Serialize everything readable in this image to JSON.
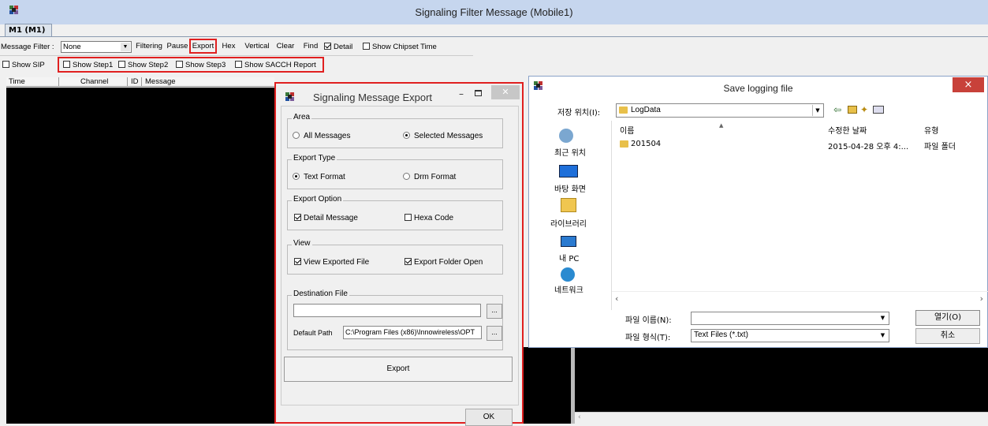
{
  "window": {
    "title": "Signaling Filter Message (Mobile1)"
  },
  "tab": {
    "label": "M1 (M1)"
  },
  "toolbar": {
    "filter_label": "Message Filter :",
    "filter_value": "None",
    "filtering": "Filtering",
    "pause": "Pause",
    "export": "Export",
    "hex": "Hex",
    "vertical": "Vertical",
    "clear": "Clear",
    "find": "Find",
    "detail": "Detail",
    "show_chipset_time": "Show Chipset Time"
  },
  "toolbar2": {
    "show_sip": "Show SIP",
    "show_step1": "Show Step1",
    "show_step2": "Show Step2",
    "show_step3": "Show Step3",
    "show_sacch": "Show SACCH Report"
  },
  "columns": [
    "Time",
    "Channel",
    "ID",
    "Message"
  ],
  "export_dialog": {
    "title": "Signaling Message Export",
    "area": {
      "label": "Area",
      "all": "All Messages",
      "selected": "Selected Messages"
    },
    "type": {
      "label": "Export Type",
      "text": "Text Format",
      "drm": "Drm Format"
    },
    "option": {
      "label": "Export Option",
      "detail": "Detail Message",
      "hexa": "Hexa Code"
    },
    "view": {
      "label": "View",
      "view_file": "View Exported File",
      "folder_open": "Export Folder Open"
    },
    "dest": {
      "label": "Destination File",
      "value": "",
      "browse": "...",
      "default_label": "Default Path",
      "default_value": "C:\\Program Files (x86)\\Innowireless\\OPT",
      "browse2": "..."
    },
    "export_btn": "Export",
    "ok_btn": "OK"
  },
  "save_dialog": {
    "title": "Save logging file",
    "close": "×",
    "location_label": "저장 위치(I):",
    "location_value": "LogData",
    "places": [
      "최근 위치",
      "바탕 화면",
      "라이브러리",
      "내 PC",
      "네트워크"
    ],
    "col_name": "이름",
    "col_date": "수정한 날짜",
    "col_type": "유형",
    "files": [
      {
        "name": "201504",
        "date": "2015-04-28 오후 4:...",
        "type": "파일 폴더"
      }
    ],
    "filename_label": "파일 이름(N):",
    "filename_value": "",
    "filetype_label": "파일 형식(T):",
    "filetype_value": "Text Files (*.txt)",
    "open_btn": "열기(O)",
    "cancel_btn": "취소"
  }
}
